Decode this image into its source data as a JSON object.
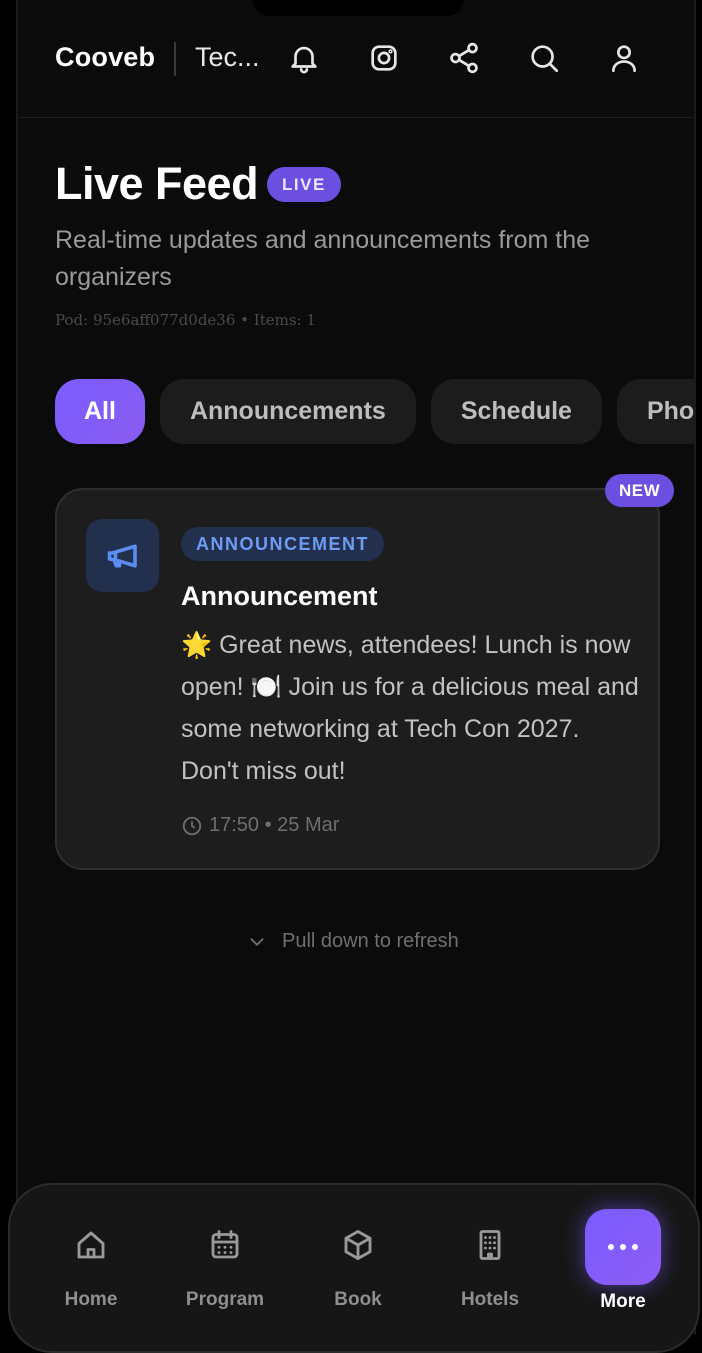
{
  "header": {
    "brand": "Cooveb",
    "event_name": "Tec...",
    "icons": [
      "bell-icon",
      "instagram-icon",
      "share-icon",
      "search-icon",
      "user-icon"
    ]
  },
  "page": {
    "title": "Live Feed",
    "live_badge": "LIVE",
    "subtitle": "Real-time updates and announcements from the organizers",
    "meta": "Pod: 95e6aff077d0de36 • Items: 1"
  },
  "filters": [
    {
      "label": "All",
      "active": true
    },
    {
      "label": "Announcements",
      "active": false
    },
    {
      "label": "Schedule",
      "active": false
    },
    {
      "label": "Pho",
      "active": false
    }
  ],
  "feed": [
    {
      "new_badge": "NEW",
      "icon": "megaphone-icon",
      "tag": "ANNOUNCEMENT",
      "title": "Announcement",
      "body": "🌟 Great news, attendees! Lunch is now open! 🍽️ Join us for a delicious meal and some networking at Tech Con 2027. Don't miss out!",
      "time": "17:50 • 25 Mar"
    }
  ],
  "refresh_hint": "Pull down to refresh",
  "bottom_nav": [
    {
      "label": "Home",
      "icon": "home-icon"
    },
    {
      "label": "Program",
      "icon": "calendar-icon"
    },
    {
      "label": "Book",
      "icon": "box-icon"
    },
    {
      "label": "Hotels",
      "icon": "building-icon"
    },
    {
      "label": "More",
      "icon": "more-dots-icon"
    }
  ],
  "colors": {
    "accent": "#7a5cff",
    "background": "#0b0b0b",
    "card": "#1d1d1d",
    "tag_blue": "#6e9cf5"
  }
}
